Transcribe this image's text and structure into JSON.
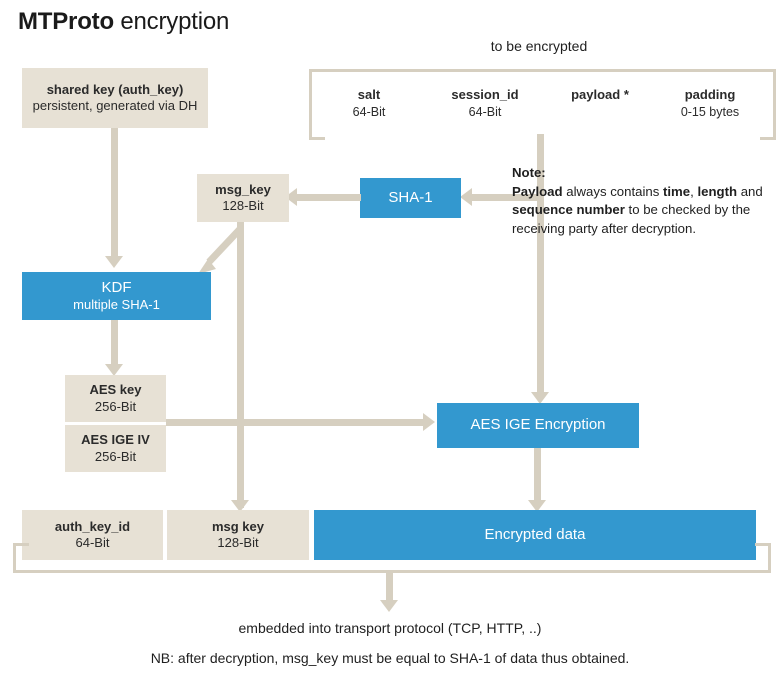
{
  "title": {
    "strong": "MTProto",
    "rest": " encryption"
  },
  "palette": {
    "blue": "#3398cf",
    "beige": "#e7e1d5",
    "line": "#d6cfc0",
    "text": "#1f1f1f"
  },
  "shared_key_box": {
    "name": "shared key (auth_key)",
    "sub": "persistent, generated via DH"
  },
  "to_be_encrypted": {
    "label": "to be encrypted",
    "segments": [
      {
        "name": "salt",
        "sub": "64-Bit"
      },
      {
        "name": "session_id",
        "sub": "64-Bit"
      },
      {
        "name": "payload *",
        "sub": ""
      },
      {
        "name": "padding",
        "sub": "0-15 bytes"
      }
    ]
  },
  "msg_key_box": {
    "name": "msg_key",
    "sub": "128-Bit"
  },
  "sha1_box": {
    "name": "SHA-1",
    "sub": ""
  },
  "kdf_box": {
    "name": "KDF",
    "sub": "multiple SHA-1"
  },
  "aes_key_box": {
    "name": "AES key",
    "sub": "256-Bit"
  },
  "aes_iv_box": {
    "name": "AES IGE IV",
    "sub": "256-Bit"
  },
  "aes_ige_encryption_box": {
    "name": "AES IGE Encryption",
    "sub": ""
  },
  "output": {
    "auth_key_id": {
      "name": "auth_key_id",
      "sub": "64-Bit"
    },
    "msg_key": {
      "name": "msg key",
      "sub": "128-Bit"
    },
    "encrypted_data": {
      "name": "Encrypted data",
      "sub": ""
    }
  },
  "note": {
    "heading": "Note:",
    "line1_a": "Payload",
    "line1_b": " always contains ",
    "line1_c": "time",
    "line1_d": ",",
    "line2_a": "length",
    "line2_b": " and ",
    "line2_c": "sequence number",
    "line3": "to be checked by the receiving",
    "line4": "party after decryption."
  },
  "footer": {
    "line1": "embedded into transport protocol (TCP, HTTP, ..)",
    "line2": "NB: after decryption, msg_key must be equal to SHA-1 of data thus obtained."
  }
}
